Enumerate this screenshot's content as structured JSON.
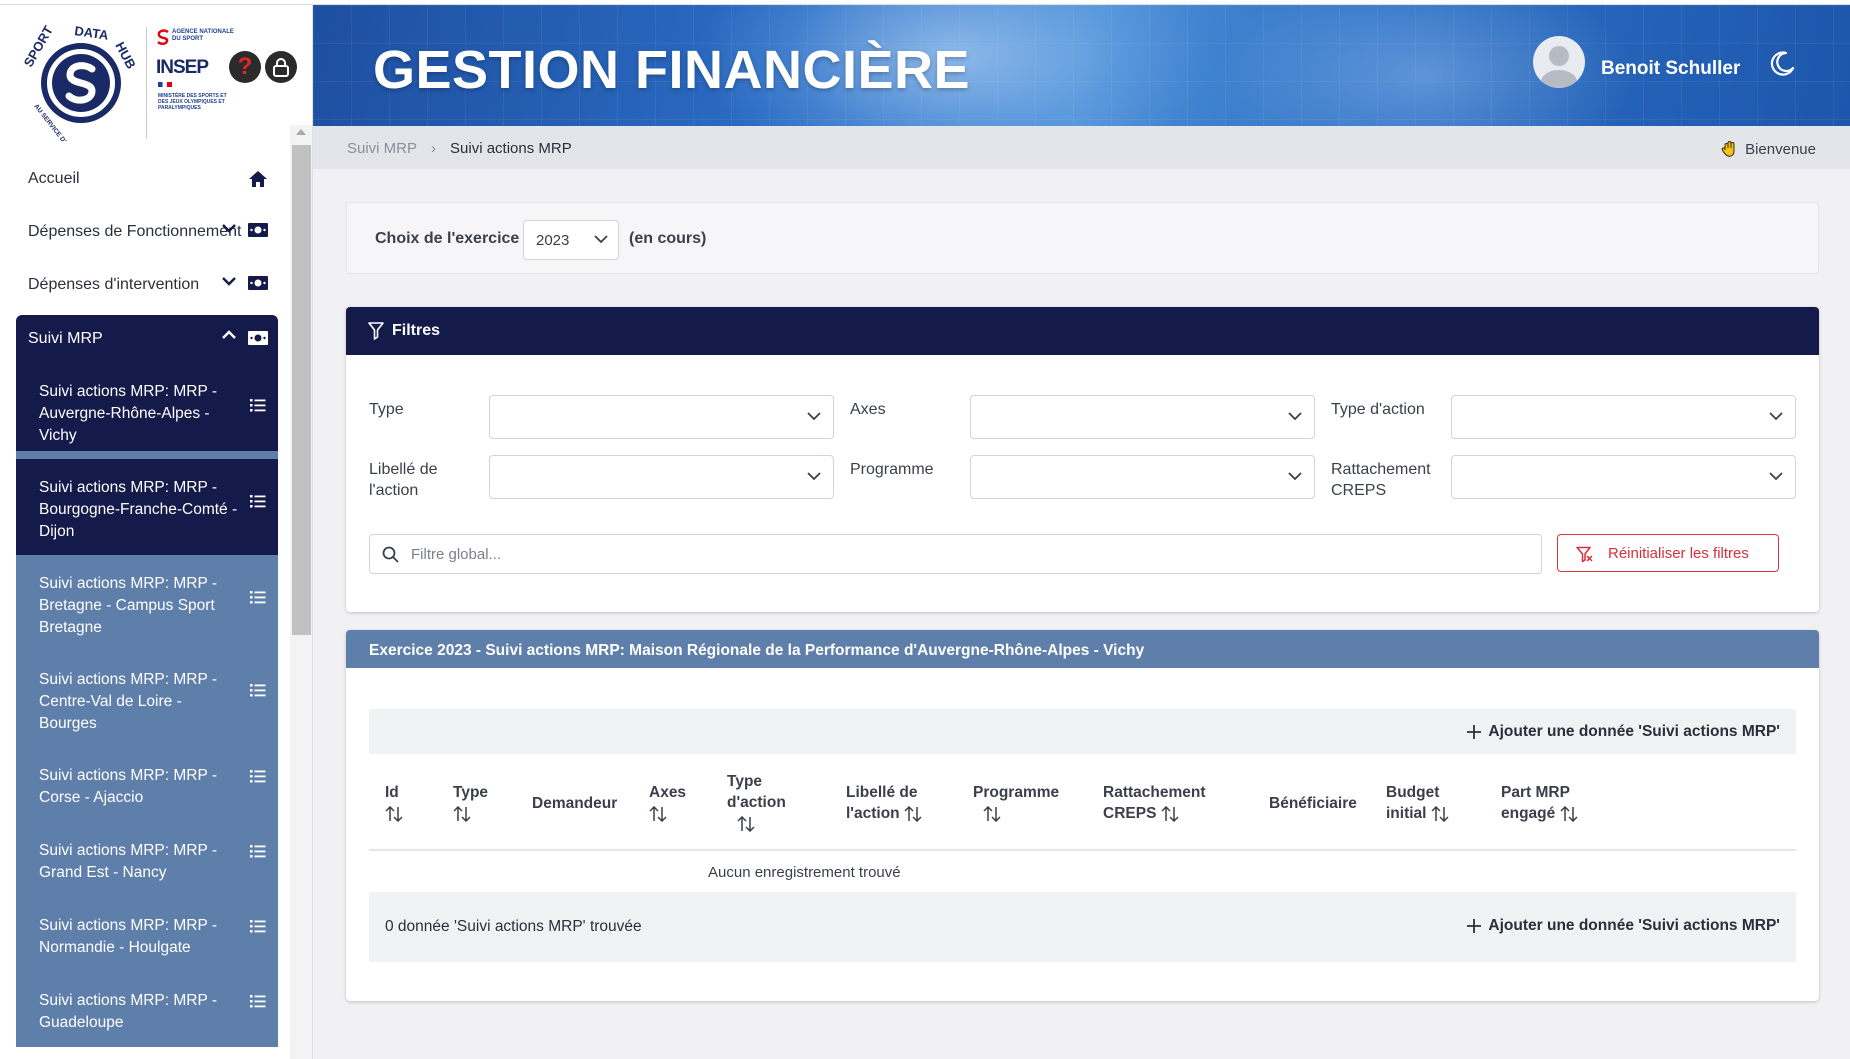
{
  "app": {
    "title": "GESTION FINANCIÈRE",
    "user": "Benoit Schuller",
    "logo_text": "SPORT DATA HUB",
    "logo_tagline": "AU SERVICE DE LA PERFORMANCE",
    "agency_line": "AGENCE NATIONALE DU SPORT",
    "insep": "INSEP",
    "ministry": "MINISTÈRE DES SPORTS ET DES JEUX OLYMPIQUES ET PARALYMPIQUES"
  },
  "sidebar": {
    "items": [
      {
        "label": "Accueil",
        "icon": "home-icon"
      },
      {
        "label": "Dépenses de Fonctionnement",
        "icon": "money-icon"
      },
      {
        "label": "Dépenses d'intervention",
        "icon": "money-icon"
      },
      {
        "label": "Suivi MRP",
        "icon": "money-icon"
      }
    ],
    "sub_items": [
      "Suivi actions MRP: MRP - Auvergne-Rhône-Alpes - Vichy",
      "Suivi actions MRP: MRP - Bourgogne-Franche-Comté - Dijon",
      "Suivi actions MRP: MRP - Bretagne - Campus Sport Bretagne",
      "Suivi actions MRP: MRP - Centre-Val de Loire - Bourges",
      "Suivi actions MRP: MRP - Corse - Ajaccio",
      "Suivi actions MRP: MRP - Grand Est - Nancy",
      "Suivi actions MRP: MRP - Normandie - Houlgate",
      "Suivi actions MRP: MRP - Guadeloupe"
    ]
  },
  "breadcrumb": {
    "parent": "Suivi MRP",
    "separator": "›",
    "current": "Suivi actions MRP",
    "welcome": "Bienvenue"
  },
  "exercise": {
    "label": "Choix de l'exercice",
    "value": "2023",
    "status": "(en cours)"
  },
  "filters": {
    "title": "Filtres",
    "type": "Type",
    "axes": "Axes",
    "type_action": "Type d'action",
    "libelle": "Libellé de l'action",
    "programme": "Programme",
    "rattachement": "Rattachement CREPS",
    "global_placeholder": "Filtre global...",
    "reset": "Réinitialiser les filtres"
  },
  "results": {
    "title": "Exercice 2023 - Suivi actions MRP: Maison Régionale de la Performance d'Auvergne-Rhône-Alpes - Vichy",
    "add_label": "Ajouter une donnée 'Suivi actions MRP'",
    "columns": {
      "id": "Id",
      "type": "Type",
      "demandeur": "Demandeur",
      "axes": "Axes",
      "type_action": "Type d'action",
      "libelle": "Libellé de l'action",
      "programme": "Programme",
      "rattachement": "Rattachement CREPS",
      "beneficiaire": "Bénéficiaire",
      "budget": "Budget initial",
      "part": "Part MRP engagé"
    },
    "empty": "Aucun enregistrement trouvé",
    "count": "0 donnée 'Suivi actions MRP' trouvée"
  },
  "colors": {
    "navy": "#141a4a",
    "steel_blue": "#5f7fab",
    "danger": "#d6303a"
  }
}
